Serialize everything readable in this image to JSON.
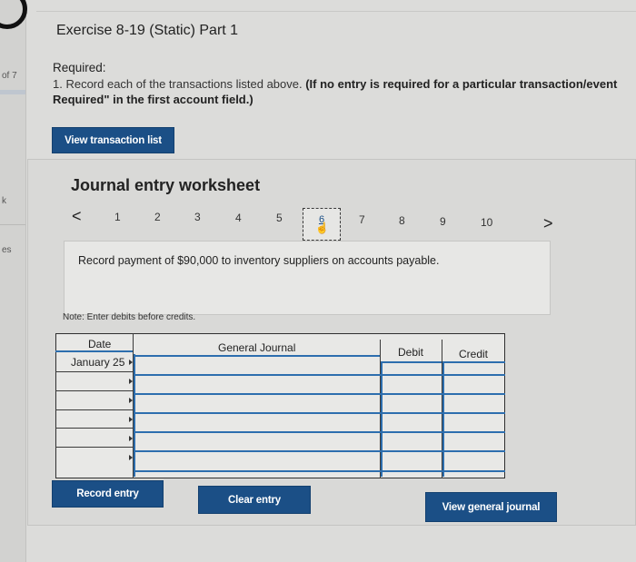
{
  "sidebar": {
    "part_label": "of 7",
    "part_label_2": "k",
    "part_label_3": "es"
  },
  "exercise": {
    "title": "Exercise 8-19 (Static) Part 1",
    "required_label": "Required:",
    "instruction_plain": "1. Record each of the transactions listed above. ",
    "instruction_bold_1": "(If no entry is required for a particular transaction/event",
    "instruction_bold_2": "Required\" in the first account field.)"
  },
  "buttons": {
    "view_transaction_list": "View transaction list",
    "record_entry": "Record entry",
    "clear_entry": "Clear entry",
    "view_general_journal": "View general journal"
  },
  "worksheet": {
    "title": "Journal entry worksheet",
    "pager": {
      "prev": "<",
      "next": ">",
      "pages": [
        "1",
        "2",
        "3",
        "4",
        "5",
        "6",
        "7",
        "8",
        "9",
        "10"
      ],
      "current": "6"
    },
    "description": "Record payment of $90,000 to inventory suppliers on accounts payable.",
    "note": "Note: Enter debits before credits."
  },
  "journal_table": {
    "headers": {
      "date": "Date",
      "general_journal": "General Journal",
      "debit": "Debit",
      "credit": "Credit"
    },
    "rows": [
      {
        "date": "January 25",
        "account": "",
        "debit": "",
        "credit": ""
      },
      {
        "date": "",
        "account": "",
        "debit": "",
        "credit": ""
      },
      {
        "date": "",
        "account": "",
        "debit": "",
        "credit": ""
      },
      {
        "date": "",
        "account": "",
        "debit": "",
        "credit": ""
      },
      {
        "date": "",
        "account": "",
        "debit": "",
        "credit": ""
      },
      {
        "date": "",
        "account": "",
        "debit": "",
        "credit": ""
      }
    ]
  },
  "colors": {
    "button_blue": "#1b4f86",
    "focus_blue": "#2d6eae",
    "background": "#dcdcda"
  },
  "icons": [
    "chevron-left-icon",
    "chevron-right-icon",
    "hand-cursor-icon",
    "logo-icon"
  ]
}
